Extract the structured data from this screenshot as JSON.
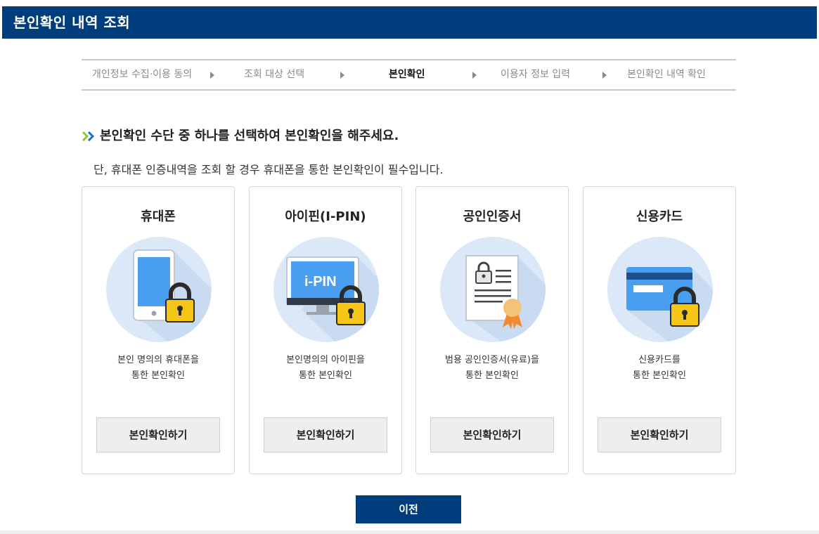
{
  "header": {
    "title": "본인확인 내역 조회"
  },
  "steps": [
    {
      "label": "개인정보 수집·이용 동의",
      "active": false
    },
    {
      "label": "조회 대상 선택",
      "active": false
    },
    {
      "label": "본인확인",
      "active": true
    },
    {
      "label": "이용자 정보 입력",
      "active": false
    },
    {
      "label": "본인확인 내역 확인",
      "active": false
    }
  ],
  "main": {
    "headline": "본인확인 수단 중 하나를 선택하여 본인확인을 해주세요.",
    "note": "단, 휴대폰 인증내역을 조회 할 경우 휴대폰을 통한 본인확인이 필수입니다."
  },
  "methods": [
    {
      "title": "휴대폰",
      "icon": "phone-lock-icon",
      "desc1": "본인 명의의 휴대폰을",
      "desc2": "통한 본인확인",
      "button": "본인확인하기"
    },
    {
      "title": "아이핀(I-PIN)",
      "icon": "ipin-monitor-lock-icon",
      "screen_text": "i-PIN",
      "desc1": "본인명의의 아이핀을",
      "desc2": "통한 본인확인",
      "button": "본인확인하기"
    },
    {
      "title": "공인인증서",
      "icon": "certificate-icon",
      "desc1": "범용 공인인증서(유료)을",
      "desc2": "통한 본인확인",
      "button": "본인확인하기"
    },
    {
      "title": "신용카드",
      "icon": "credit-card-lock-icon",
      "desc1": "신용카드를",
      "desc2": "통한 본인확인",
      "button": "본인확인하기"
    }
  ],
  "footer": {
    "prev_label": "이전"
  },
  "colors": {
    "header_bg": "#003d7c",
    "accent_green": "#8cc63f",
    "circle_bg": "#dbe8f8",
    "lock_yellow": "#f5c518"
  }
}
